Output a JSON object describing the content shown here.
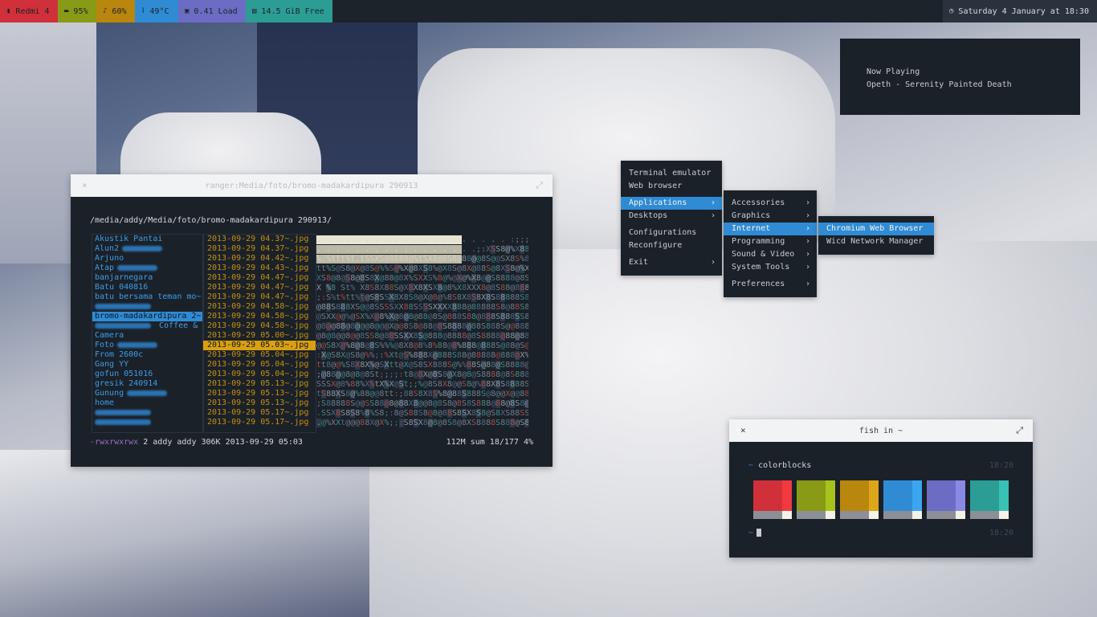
{
  "topbar": {
    "segments": [
      {
        "icon": "signal-icon",
        "label": "Redmi 4"
      },
      {
        "icon": "battery-icon",
        "label": "95%"
      },
      {
        "icon": "bell-icon",
        "label": "60%"
      },
      {
        "icon": "thermometer-icon",
        "label": "49°C"
      },
      {
        "icon": "cpu-icon",
        "label": "0.41 Load"
      },
      {
        "icon": "disk-icon",
        "label": "14.5 GiB Free"
      }
    ],
    "clock": {
      "icon": "clock-icon",
      "label": "Saturday 4 January at 18:30"
    },
    "colors": [
      "#d0303a",
      "#889a16",
      "#b9860e",
      "#2f8bd4",
      "#6c6cc4",
      "#2b9d95"
    ]
  },
  "now_playing": {
    "heading": "Now Playing",
    "track": "Opeth - Serenity Painted Death"
  },
  "ranger": {
    "title": "ranger:Media/foto/bromo-madakardipura 290913",
    "path": "/media/addy/Media/foto/bromo-madakardipura 290913/",
    "folders": [
      {
        "name": "Akustik Pantai",
        "blurred": false
      },
      {
        "name": "Alun2",
        "blurred": true
      },
      {
        "name": "Arjuno",
        "blurred": false
      },
      {
        "name": "Atap",
        "blurred": true
      },
      {
        "name": "banjarnegara",
        "blurred": false
      },
      {
        "name": "Batu 040816",
        "blurred": false
      },
      {
        "name": "batu bersama teman mo~",
        "blurred": false
      },
      {
        "name": "",
        "blurred": true
      },
      {
        "name": "bromo-madakardipura 2~",
        "blurred": false,
        "selected": true
      },
      {
        "name": "Coffee & KFC",
        "blurred": true,
        "blur_first": true
      },
      {
        "name": "Camera",
        "blurred": false
      },
      {
        "name": "Foto",
        "blurred": true
      },
      {
        "name": "From 2600c",
        "blurred": false
      },
      {
        "name": "Gang YY",
        "blurred": false
      },
      {
        "name": "gofun 051016",
        "blurred": false
      },
      {
        "name": "gresik 240914",
        "blurred": false
      },
      {
        "name": "Gunung",
        "blurred": true
      },
      {
        "name": "home",
        "blurred": false
      },
      {
        "name": "",
        "blurred": true
      },
      {
        "name": "",
        "blurred": true
      }
    ],
    "files": [
      "2013-09-29 04.37~.jpg",
      "2013-09-29 04.37~.jpg",
      "2013-09-29 04.42~.jpg",
      "2013-09-29 04.43~.jpg",
      "2013-09-29 04.47~.jpg",
      "2013-09-29 04.47~.jpg",
      "2013-09-29 04.47~.jpg",
      "2013-09-29 04.58~.jpg",
      "2013-09-29 04.58~.jpg",
      "2013-09-29 04.58~.jpg",
      "2013-09-29 05.00~.jpg",
      "2013-09-29 05.03~.jpg",
      "2013-09-29 05.04~.jpg",
      "2013-09-29 05.04~.jpg",
      "2013-09-29 05.04~.jpg",
      "2013-09-29 05.13~.jpg",
      "2013-09-29 05.13~.jpg",
      "2013-09-29 05.13~.jpg",
      "2013-09-29 05.17~.jpg",
      "2013-09-29 05.17~.jpg"
    ],
    "selected_file_index": 11,
    "preview_lines": [
      ". . . . . . . . . . . . . . . . . . . . :;;;%XX@S8888S@St  t@",
      ". . . . . . . . . . . . . . . . .;:XSS8@%X88%S@@%X@%%SS8S",
      "%:%ttt%t.tSSXS@8888@%tSX8@8S8@88@@8S@@SX8S%8XS8X%X@88",
      "tt%S@S8@X@8S@%%S@%X@8XS8%@X8S@8X@88S@8XS8@%X8@S8X88",
      "XS8@8@S8@8S8X@88@8X%SXXS%8@%@X@%X8@@S8888@8S888888S@",
      "X %8 St% X8S8X88S@X8X8XSX8@8%X8XXX8@8S88@8888S888888",
      ";:S%t%tt%t@S8SSX8X8S8@X@8@%8S8X8S8X8S88888S8@88S88S",
      "@88S888XS@@8SSSSXX88SSSSXXXX888@88888S8@88S888888XSS",
      "@SXX@@%@SX%X@8%X@8@8@88@8S@888S88@888S888SS8@@88888",
      "@8@@88@8@@@8@@@X@@8S8@88@8S8888@88S888S@@888X@SXt%",
      "@8@8@@8@@8SS8@88SSXX8S@888@8888@8S8888@88@88X@XSS",
      "@@S8X@%8@8@8S%%%@8X8@8%8%88@8%888@888S@88@S@X@X%@S%",
      ":X@S8X@S8@%%;:%Xt@S%888X@888S88@88888@888@X%%X@@SX%",
      "tt8@@%S8X8X%@SXtt@X@S8SX888S@%%88S@88@S8888@888S88SX",
      ";@88@@8@8@8St;;;;:t8@8X@8S8@X8@8@S8888@8S888888888X",
      "SSSX@8%88%X%tX%X@St;;%@8S8X8@@S8@%88X8S8888S@8888X%8X",
      "tS88XS8@%88@@8tt:;88S8X8S%8@88S888S@8@@X@@88@8SS8@X",
      ";S88888S@@SS88@8@88X8@@8@8S8@8S8S888@88@8S8@88SSS8X",
      ".SSX8S8S8%8%S8;:8@S88S8@8@88S8SX8S8@S8XS88SS888SS8X%",
      ".@%XXt@@@88X@X%;;:S8SX8@8@8S8@8XS8888S888@S8888SS88"
    ],
    "status": {
      "perm": "-rwxrwxrwx",
      "info": "2 addy addy 306K 2013-09-29 05:03",
      "right": "112M sum   18/177   4%"
    }
  },
  "menus": {
    "root": [
      {
        "label": "Terminal emulator",
        "submenu": false
      },
      {
        "label": "Web browser",
        "submenu": false
      },
      {
        "gap": true
      },
      {
        "label": "Applications",
        "submenu": true,
        "active": true
      },
      {
        "label": "Desktops",
        "submenu": true
      },
      {
        "gap": true
      },
      {
        "label": "Configurations",
        "submenu": false
      },
      {
        "label": "Reconfigure",
        "submenu": false
      },
      {
        "gap": true
      },
      {
        "label": "Exit",
        "submenu": true
      }
    ],
    "applications": [
      {
        "label": "Accessories",
        "submenu": true
      },
      {
        "label": "Graphics",
        "submenu": true
      },
      {
        "label": "Internet",
        "submenu": true,
        "active": true
      },
      {
        "label": "Programming",
        "submenu": true
      },
      {
        "label": "Sound & Video",
        "submenu": true
      },
      {
        "label": "System Tools",
        "submenu": true
      },
      {
        "gap": true
      },
      {
        "label": "Preferences",
        "submenu": true
      }
    ],
    "internet": [
      {
        "label": "Chromium Web Browser",
        "active": true
      },
      {
        "label": "Wicd Network Manager"
      }
    ],
    "arrow": "›"
  },
  "fish": {
    "title": "fish in ~",
    "prompt_symbol": "~",
    "command": "colorblocks",
    "time1": "18:20",
    "time2": "18:20",
    "colors": [
      {
        "main": "#d0303a",
        "bright": "#f03a40"
      },
      {
        "main": "#889a16",
        "bright": "#a8c21c"
      },
      {
        "main": "#b9860e",
        "bright": "#dda51a"
      },
      {
        "main": "#2f8bd4",
        "bright": "#3aa6f2"
      },
      {
        "main": "#6c6cc4",
        "bright": "#8a8ae6"
      },
      {
        "main": "#2b9d95",
        "bright": "#38c2b5"
      }
    ]
  },
  "window_controls": {
    "close": "×",
    "maximize": "⤢"
  }
}
